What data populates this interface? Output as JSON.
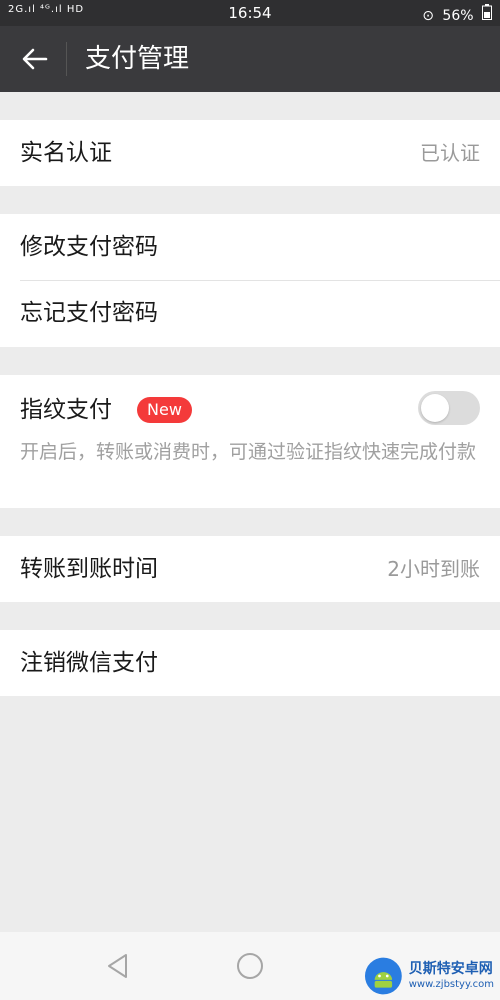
{
  "status_bar": {
    "signal_left": "2G.ıl ⁴ᴳ.ıl HD",
    "time": "16:54",
    "battery": "56%"
  },
  "header": {
    "title": "支付管理"
  },
  "sections": {
    "real_name": {
      "label": "实名认证",
      "value": "已认证"
    },
    "change_password": {
      "label": "修改支付密码"
    },
    "forgot_password": {
      "label": "忘记支付密码"
    },
    "fingerprint": {
      "label": "指纹支付",
      "badge": "New",
      "enabled": false,
      "description": "开启后，转账或消费时，可通过验证指纹快速完成付款"
    },
    "transfer_time": {
      "label": "转账到账时间",
      "value": "2小时到账"
    },
    "cancel_wechat_pay": {
      "label": "注销微信支付"
    }
  },
  "watermark": {
    "title": "贝斯特安卓网",
    "url": "www.zjbstyy.com"
  },
  "colors": {
    "header_bg": "#3a3a3d",
    "badge_red": "#f43a3a",
    "page_bg": "#ececec"
  }
}
